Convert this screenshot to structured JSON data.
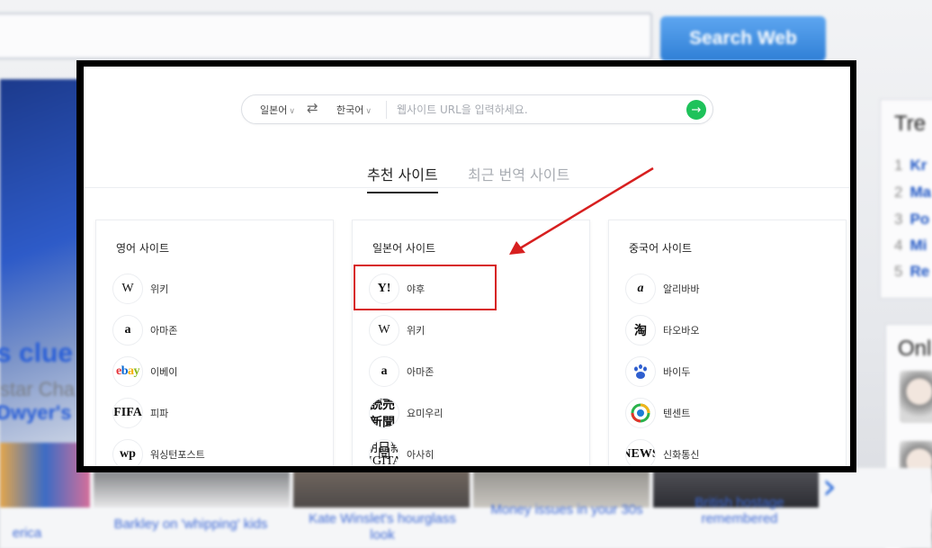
{
  "background": {
    "search_button": "Search Web",
    "hero_line1": "s clue",
    "hero_line2": "star Cha",
    "hero_line3": "Dwyer's",
    "side_title": "Tre",
    "side_rows": [
      {
        "num": "1",
        "text": "Kr"
      },
      {
        "num": "2",
        "text": "Ma"
      },
      {
        "num": "3",
        "text": "Po"
      },
      {
        "num": "4",
        "text": "Mi"
      },
      {
        "num": "5",
        "text": "Re"
      }
    ],
    "side2_title": "Onl",
    "captions": [
      "erica",
      "Barkley on 'whipping' kids",
      "Kate Winslet's hourglass look",
      "Money issues in your 30s",
      "British hostage remembered"
    ]
  },
  "translator": {
    "source_lang": "일본어",
    "target_lang": "한국어",
    "url_placeholder": "웹사이트 URL을 입력하세요.",
    "tabs": [
      {
        "label": "추천 사이트",
        "active": true
      },
      {
        "label": "최근 번역 사이트",
        "active": false
      }
    ],
    "cards": [
      {
        "title": "영어 사이트",
        "sites": [
          {
            "name": "위키",
            "logo": "W",
            "icon": "wikipedia-icon"
          },
          {
            "name": "아마존",
            "logo": "a",
            "icon": "amazon-icon"
          },
          {
            "name": "이베이",
            "logo": "ebay",
            "icon": "ebay-icon"
          },
          {
            "name": "피파",
            "logo": "FIFA",
            "icon": "fifa-icon"
          },
          {
            "name": "워싱턴포스트",
            "logo": "wp",
            "icon": "washington-post-icon"
          }
        ]
      },
      {
        "title": "일본어 사이트",
        "sites": [
          {
            "name": "야후",
            "logo": "Y!",
            "icon": "yahoo-icon"
          },
          {
            "name": "위키",
            "logo": "W",
            "icon": "wikipedia-icon"
          },
          {
            "name": "아마존",
            "logo": "a",
            "icon": "amazon-icon"
          },
          {
            "name": "요미우리",
            "logo": "読売新聞",
            "icon": "yomiuri-icon"
          },
          {
            "name": "아사히",
            "logo": "朝日新聞 DIGITAL",
            "icon": "asahi-icon"
          }
        ]
      },
      {
        "title": "중국어 사이트",
        "sites": [
          {
            "name": "알리바바",
            "logo": "a",
            "icon": "alibaba-icon"
          },
          {
            "name": "타오바오",
            "logo": "淘",
            "icon": "taobao-icon"
          },
          {
            "name": "바이두",
            "logo": "du",
            "icon": "baidu-icon"
          },
          {
            "name": "텐센트",
            "logo": "",
            "icon": "tencent-icon"
          },
          {
            "name": "신화통신",
            "logo": "NEWS",
            "icon": "xinhua-icon"
          }
        ]
      }
    ]
  },
  "colors": {
    "highlight": "#d71f1f",
    "go_button": "#1ec25a",
    "frame": "#000000"
  }
}
